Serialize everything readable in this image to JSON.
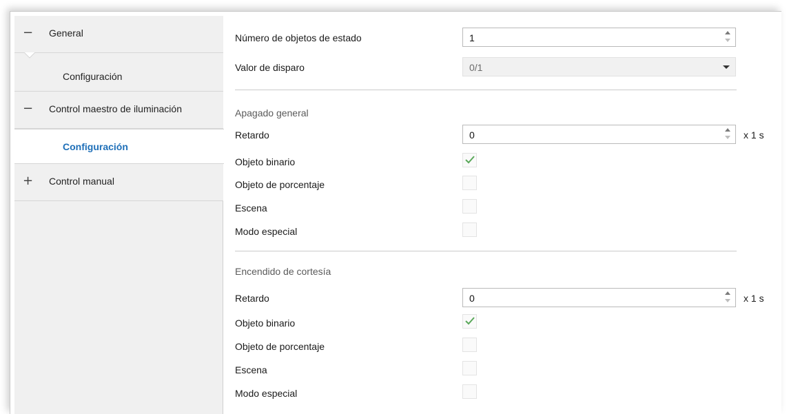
{
  "sidebar": {
    "items": [
      {
        "symbol": "−",
        "label": "General"
      },
      {
        "label": "Configuración"
      },
      {
        "symbol": "−",
        "label": "Control maestro de iluminación"
      },
      {
        "label": "Configuración"
      },
      {
        "symbol": "+",
        "label": "Control manual"
      }
    ]
  },
  "main": {
    "status_objects": {
      "label": "Número de objetos de estado",
      "value": "1"
    },
    "trigger_value": {
      "label": "Valor de disparo",
      "value": "0/1"
    },
    "general_off": {
      "title": "Apagado general",
      "delay": {
        "label": "Retardo",
        "value": "0",
        "unit": "x 1 s"
      },
      "binary": {
        "label": "Objeto binario",
        "checked": true
      },
      "percentage": {
        "label": "Objeto de porcentaje",
        "checked": false
      },
      "scene": {
        "label": "Escena",
        "checked": false
      },
      "special": {
        "label": "Modo especial",
        "checked": false
      }
    },
    "courtesy_on": {
      "title": "Encendido de cortesía",
      "delay": {
        "label": "Retardo",
        "value": "0",
        "unit": "x 1 s"
      },
      "binary": {
        "label": "Objeto binario",
        "checked": true
      },
      "percentage": {
        "label": "Objeto de porcentaje",
        "checked": false
      },
      "scene": {
        "label": "Escena",
        "checked": false
      },
      "special": {
        "label": "Modo especial",
        "checked": false
      }
    }
  },
  "colors": {
    "accent": "#1e6fb8",
    "check": "#5aa85a"
  }
}
